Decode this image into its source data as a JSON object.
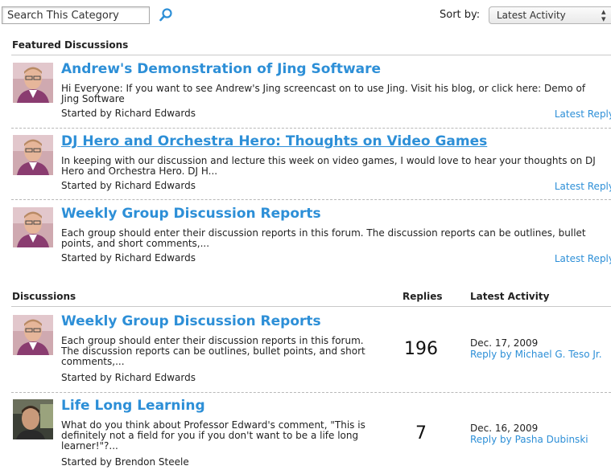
{
  "search": {
    "placeholder": "Search This Category"
  },
  "sort": {
    "label": "Sort by:",
    "selected": "Latest Activity"
  },
  "featured": {
    "heading": "Featured Discussions",
    "items": [
      {
        "title": "Andrew's Demonstration of Jing Software",
        "description": "Hi Everyone: If you want to see Andrew's Jing screencast on to use Jing. Visit his blog, or click here: Demo of Jing Software",
        "started_by": "Started by Richard Edwards",
        "reply_link": "Latest Reply"
      },
      {
        "title": "DJ Hero and Orchestra Hero: Thoughts on Video Games",
        "description": "In keeping with our discussion and lecture this week on video games, I would love to hear your thoughts on DJ Hero and Orchestra Hero. DJ H...",
        "started_by": "Started by Richard Edwards",
        "reply_link": "Latest Reply"
      },
      {
        "title": "Weekly Group Discussion Reports",
        "description": "Each group should enter their discussion reports in this forum. The discussion reports can be outlines, bullet points, and short comments,...",
        "started_by": "Started by Richard Edwards",
        "reply_link": "Latest Reply"
      }
    ]
  },
  "discussions": {
    "heading": "Discussions",
    "replies_header": "Replies",
    "activity_header": "Latest Activity",
    "items": [
      {
        "title": "Weekly Group Discussion Reports",
        "description": "Each group should enter their discussion reports in this forum. The discussion reports can be outlines, bullet points, and short comments,...",
        "started_by": "Started by Richard Edwards",
        "replies": "196",
        "date": "Dec. 17, 2009",
        "reply_by": "Reply by Michael G. Teso Jr."
      },
      {
        "title": "Life Long Learning",
        "description": "What do you think about Professor Edward's comment, \"This is definitely not a field for you if you don't want to be a life long learner!\"?...",
        "started_by": "Started by Brendon Steele",
        "replies": "7",
        "date": "Dec. 16, 2009",
        "reply_by": "Reply by Pasha Dubinski"
      }
    ]
  },
  "colors": {
    "link": "#2d8fd7",
    "text": "#222222",
    "divider": "#b8b8b8"
  },
  "icons": {
    "search": "search-icon",
    "sort_arrows": "up-down-arrows-icon"
  }
}
